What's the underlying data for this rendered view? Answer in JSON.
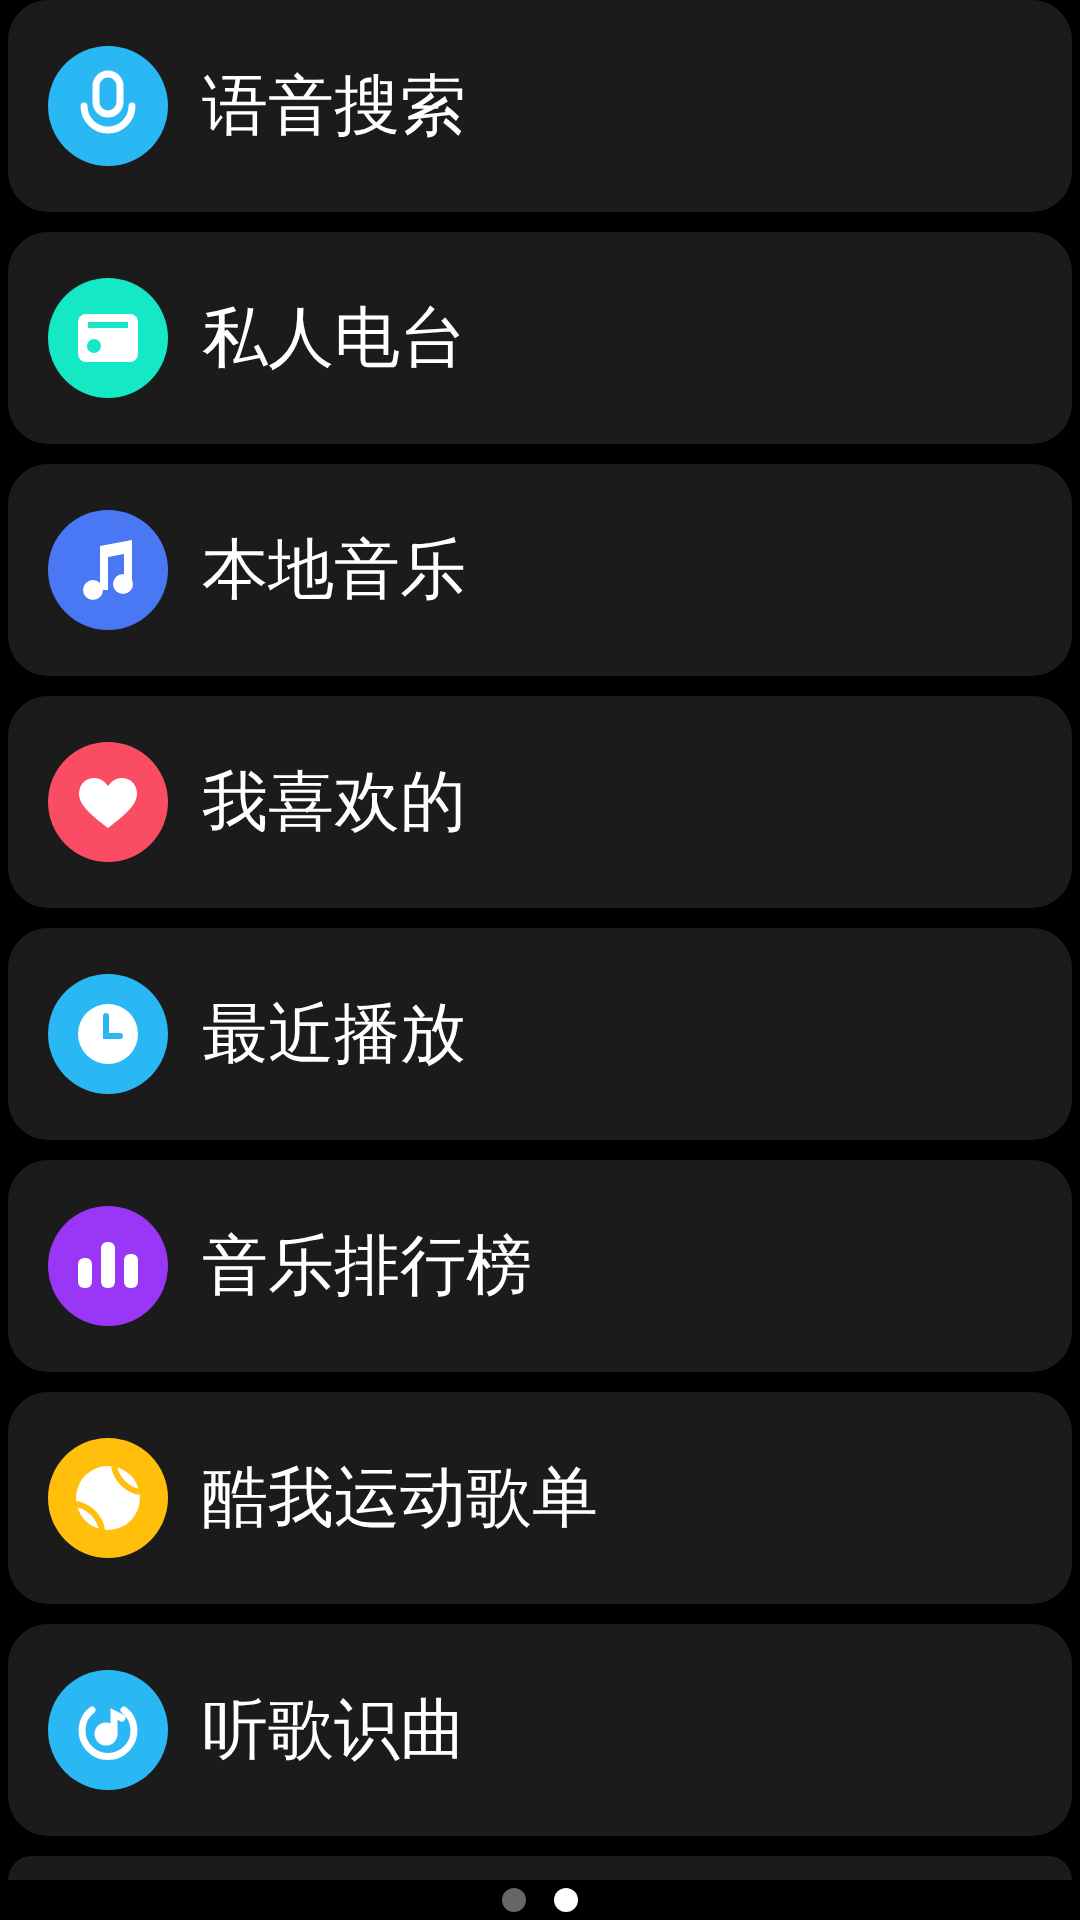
{
  "menu_items": [
    {
      "label": "语音搜索",
      "kind": "mic",
      "color": "#2ab8f5"
    },
    {
      "label": "私人电台",
      "kind": "radio",
      "color": "#14e8c4"
    },
    {
      "label": "本地音乐",
      "kind": "note",
      "color": "#4a78f5"
    },
    {
      "label": "我喜欢的",
      "kind": "heart",
      "color": "#fa4d64"
    },
    {
      "label": "最近播放",
      "kind": "clock",
      "color": "#2ab8f5"
    },
    {
      "label": "音乐排行榜",
      "kind": "bars",
      "color": "#9a36f5"
    },
    {
      "label": "酷我运动歌单",
      "kind": "ball",
      "color": "#ffbf0a"
    },
    {
      "label": "听歌识曲",
      "kind": "recognize",
      "color": "#2ab8f5"
    }
  ],
  "page_dots": [
    {
      "selected": false
    },
    {
      "selected": true
    }
  ]
}
